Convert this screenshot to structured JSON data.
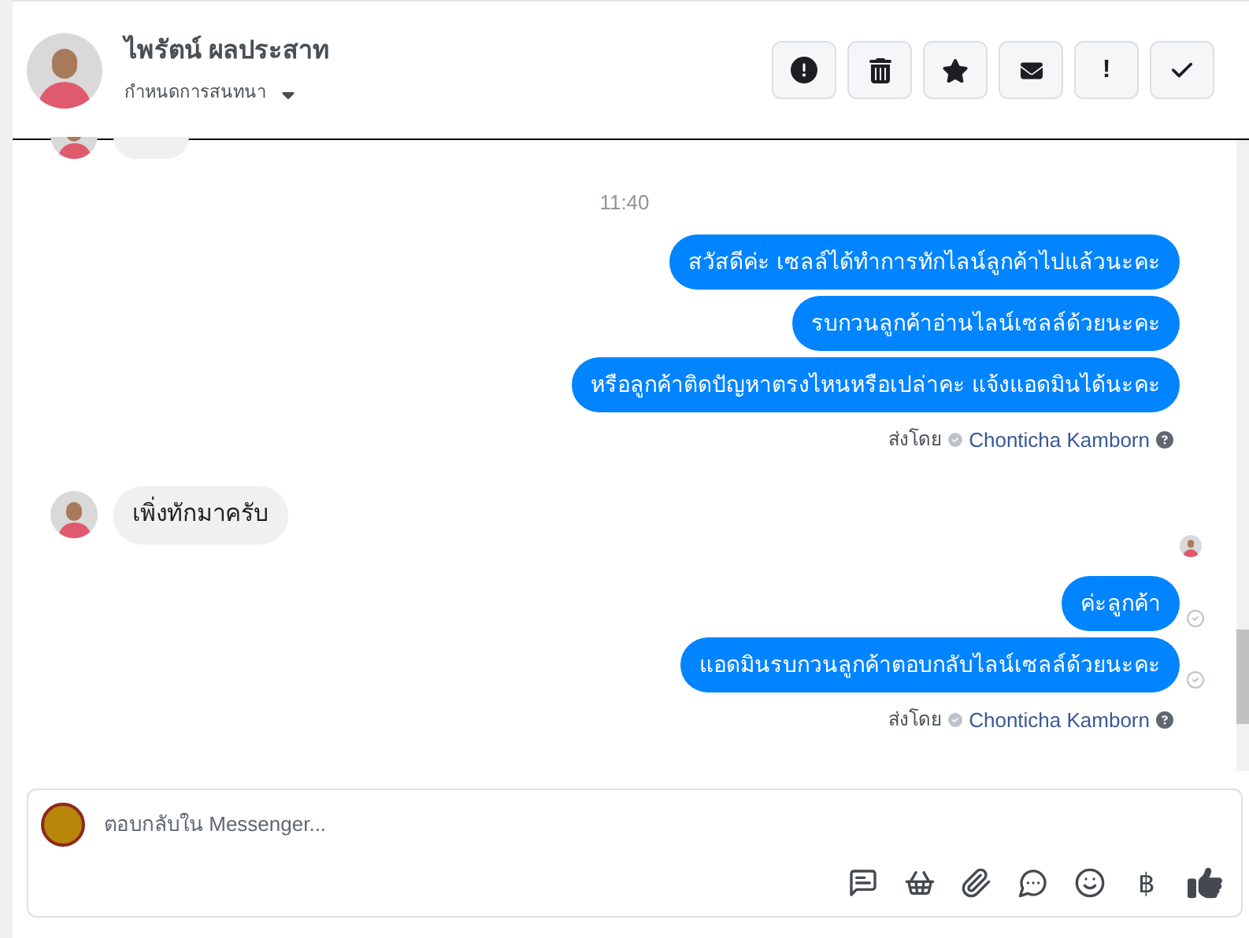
{
  "header": {
    "name": "ไพรัตน์ ผลประสาท",
    "subtitle": "กำหนดการสนทนา",
    "actions": [
      {
        "kind": "alert"
      },
      {
        "kind": "trash"
      },
      {
        "kind": "star"
      },
      {
        "kind": "mail"
      },
      {
        "kind": "exclaim",
        "label": "!"
      },
      {
        "kind": "check"
      }
    ]
  },
  "messages": [
    {
      "kind": "stub"
    },
    {
      "kind": "time",
      "text": "11:40"
    },
    {
      "kind": "out",
      "text": "สวัสดีค่ะ เซลล์ได้ทำการทักไลน์ลูกค้าไปแล้วนะคะ",
      "seen": false
    },
    {
      "kind": "out",
      "text": "รบกวนลูกค้าอ่านไลน์เซลล์ด้วยนะคะ",
      "seen": false
    },
    {
      "kind": "out",
      "text": "หรือลูกค้าติดปัญหาตรงไหนหรือเปล่าคะ แจ้งแอดมินได้นะคะ",
      "seen": false
    },
    {
      "kind": "sender",
      "prefix": "ส่งโดย",
      "name": "Chonticha Kamborn"
    },
    {
      "kind": "in",
      "text": "เพิ่งทักมาครับ"
    },
    {
      "kind": "out",
      "text": "ค่ะลูกค้า",
      "seen": true
    },
    {
      "kind": "out",
      "text": "แอดมินรบกวนลูกค้าตอบกลับไลน์เซลล์ด้วยนะคะ",
      "seen": true
    },
    {
      "kind": "sender",
      "prefix": "ส่งโดย",
      "name": "Chonticha Kamborn"
    }
  ],
  "composer": {
    "placeholder": "ตอบกลับใน Messenger...",
    "tools": [
      {
        "kind": "sticker"
      },
      {
        "kind": "bag"
      },
      {
        "kind": "clip"
      },
      {
        "kind": "chat"
      },
      {
        "kind": "smile"
      },
      {
        "kind": "baht",
        "label": "฿"
      },
      {
        "kind": "like"
      }
    ]
  }
}
